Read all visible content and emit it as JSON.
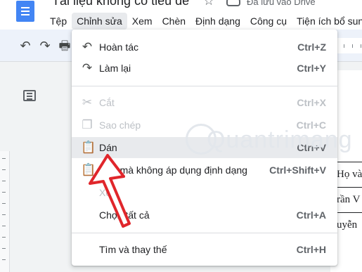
{
  "header": {
    "doc_title": "Tài liệu không có tiêu đề",
    "saved_status": "Đã lưu vào Drive",
    "icons": [
      "docs-logo",
      "star-icon",
      "cloud-icon"
    ]
  },
  "menubar": {
    "items": [
      {
        "label": "Tệp"
      },
      {
        "label": "Chỉnh sửa"
      },
      {
        "label": "Xem"
      },
      {
        "label": "Chèn"
      },
      {
        "label": "Định dạng"
      },
      {
        "label": "Công cụ"
      },
      {
        "label": "Tiện ích bổ sun"
      }
    ],
    "active_index": 1
  },
  "toolbar": {
    "icons": [
      "undo-icon",
      "redo-icon",
      "print-icon"
    ]
  },
  "edit_menu": {
    "items": [
      {
        "label": "Hoàn tác",
        "shortcut": "Ctrl+Z",
        "icon": "undo-icon",
        "enabled": true
      },
      {
        "label": "Làm lại",
        "shortcut": "Ctrl+Y",
        "icon": "redo-icon",
        "enabled": true
      },
      {
        "label": "Cắt",
        "shortcut": "Ctrl+X",
        "icon": "scissors-icon",
        "enabled": false
      },
      {
        "label": "Sao chép",
        "shortcut": "Ctrl+C",
        "icon": "copy-icon",
        "enabled": false
      },
      {
        "label": "Dán",
        "shortcut": "Ctrl+V",
        "icon": "clipboard-icon",
        "enabled": true,
        "highlighted": true
      },
      {
        "label": "Dán mà không áp dụng định dạng",
        "shortcut": "Ctrl+Shift+V",
        "icon": "clipboard-text-icon",
        "enabled": true
      },
      {
        "label": "Xóa",
        "shortcut": "",
        "icon": "",
        "enabled": false
      },
      {
        "label": "Chọn tất cả",
        "shortcut": "Ctrl+A",
        "icon": "",
        "enabled": true
      },
      {
        "label": "Tìm và thay thế",
        "shortcut": "Ctrl+H",
        "icon": "",
        "enabled": true
      }
    ]
  },
  "document": {
    "table_rows": [
      "Họ và",
      "rần V",
      "uyễn"
    ]
  },
  "watermark": "Quantrimang",
  "colors": {
    "accent": "#4285f4",
    "arrow_red": "#e0262b",
    "highlight": "#e8eaed"
  }
}
